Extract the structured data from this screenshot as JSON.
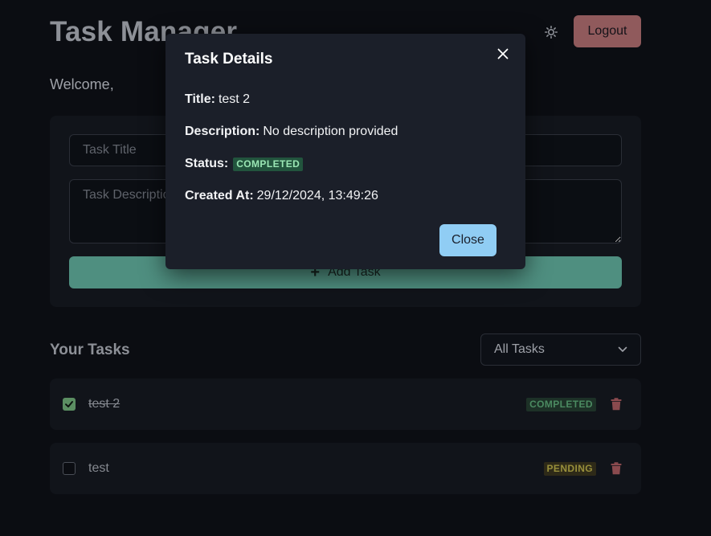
{
  "header": {
    "app_title": "Task Manager",
    "theme_icon": "sun-icon",
    "logout_label": "Logout"
  },
  "welcome_text": "Welcome,",
  "form": {
    "title_placeholder": "Task Title",
    "description_placeholder": "Task Description",
    "add_label": "Add Task",
    "add_icon": "plus-icon"
  },
  "tasks_section": {
    "heading": "Your Tasks",
    "filter_selected": "All Tasks"
  },
  "tasks": [
    {
      "title": "test 2",
      "status": "COMPLETED",
      "checked": true
    },
    {
      "title": "test",
      "status": "PENDING",
      "checked": false
    }
  ],
  "modal": {
    "title": "Task Details",
    "title_label": "Title:",
    "title_value": "test 2",
    "description_label": "Description:",
    "description_value": "No description provided",
    "status_label": "Status:",
    "status_value": "COMPLETED",
    "created_label": "Created At:",
    "created_value": "29/12/2024, 13:49:26",
    "close_label": "Close"
  },
  "colors": {
    "background": "#0b0d12",
    "modal_bg": "#1b1f29",
    "close_button": "#90cdf4",
    "logout_button": "#905a5c",
    "add_button": "#4f8f80",
    "completed_badge": "#22543d",
    "pending_badge": "#2e2a18"
  }
}
